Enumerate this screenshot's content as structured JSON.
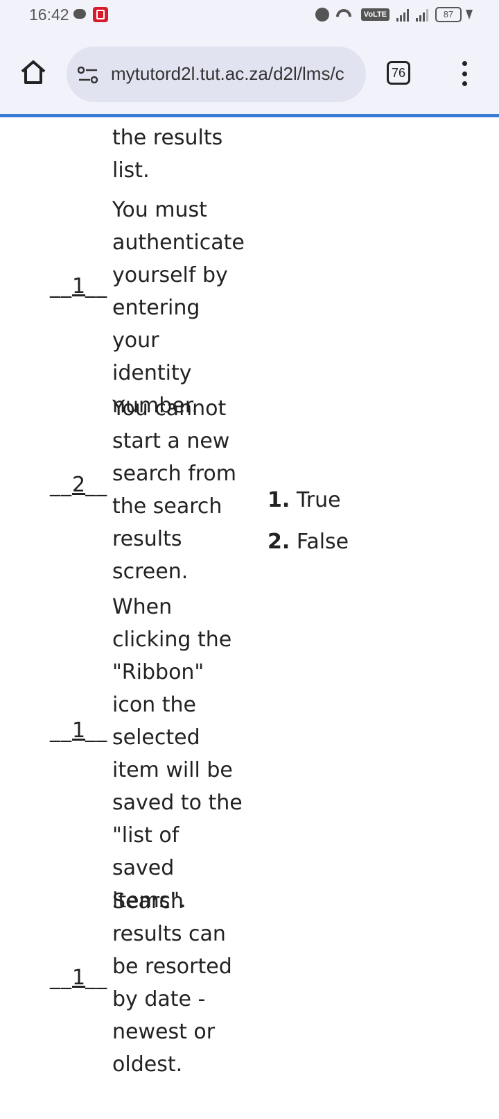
{
  "status_bar": {
    "time": "16:42",
    "battery": "87"
  },
  "toolbar": {
    "url": "mytutord2l.tut.ac.za/d2l/lms/c",
    "tab_count": "76"
  },
  "questions": [
    {
      "answer": "",
      "text": "the results list."
    },
    {
      "answer": "1",
      "text": "You must authenticate yourself by entering your identity number."
    },
    {
      "answer": "2",
      "text": "You cannot start a new search from the search results screen."
    },
    {
      "answer": "1",
      "text": "When clicking the \"Ribbon\" icon the selected item will be saved to the \"list of saved items\"."
    },
    {
      "answer": "1",
      "text": "Search results can be resorted by date  - newest or oldest."
    }
  ],
  "options": [
    {
      "number": "1.",
      "label": "True"
    },
    {
      "number": "2.",
      "label": "False"
    }
  ]
}
